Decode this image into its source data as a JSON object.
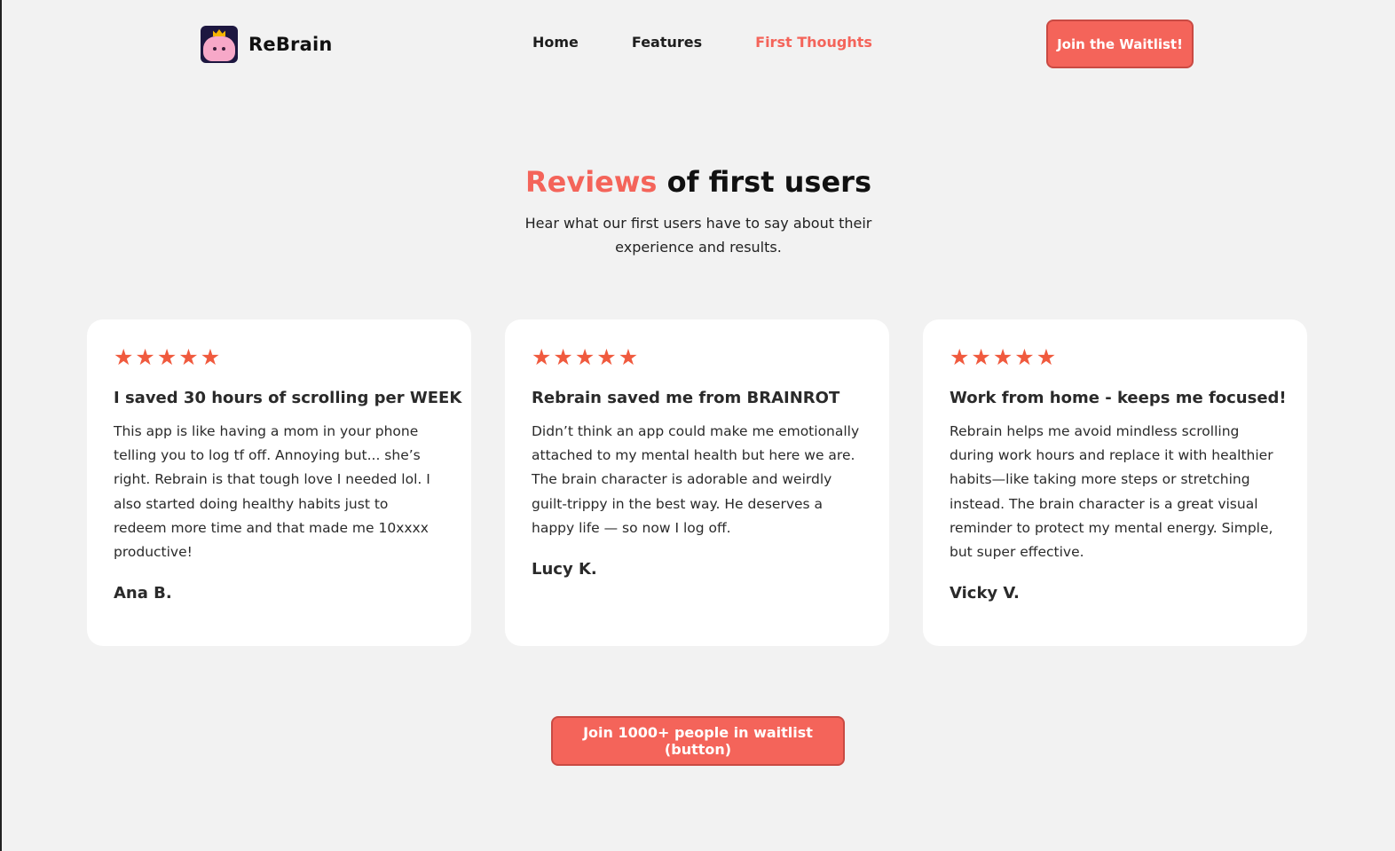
{
  "header": {
    "brand_name": "ReBrain",
    "logo_icon": "brain-crown-logo-icon",
    "nav": [
      {
        "label": "Home",
        "active": false
      },
      {
        "label": "Features",
        "active": false
      },
      {
        "label": "First Thoughts",
        "active": true
      }
    ],
    "cta_label": "Join the Waitlist!"
  },
  "section": {
    "title_accent": "Reviews",
    "title_rest": " of first users",
    "subtitle": "Hear what our first users have to say about their experience and results."
  },
  "reviews": [
    {
      "rating": 5,
      "title": "I saved 30 hours of scrolling per WEEK",
      "body": "This app is like having a mom in your phone telling you to log tf off. Annoying but... she’s right. Rebrain is that tough love I needed lol. I also started doing healthy habits just to redeem more time and that made me 10xxxx productive!",
      "author": "Ana B."
    },
    {
      "rating": 5,
      "title": "Rebrain saved me from BRAINROT",
      "body": "Didn’t think an app could make me emotionally attached to my mental health but here we are. The brain character is adorable and weirdly guilt-trippy in the best way. He deserves a happy life — so now I log off.",
      "author": "Lucy K."
    },
    {
      "rating": 5,
      "title": "Work from home - keeps me focused!",
      "body": "Rebrain helps me avoid mindless scrolling during work hours and replace it with healthier habits—like taking more steps or stretching instead. The brain character is a great visual reminder to protect my mental energy. Simple, but super effective.",
      "author": "Vicky V."
    }
  ],
  "bottom_cta_label": "Join 1000+ people in waitlist (button)",
  "colors": {
    "accent": "#f4645a",
    "star": "#f05a3e",
    "background": "#f2f2f2",
    "card": "#ffffff"
  }
}
